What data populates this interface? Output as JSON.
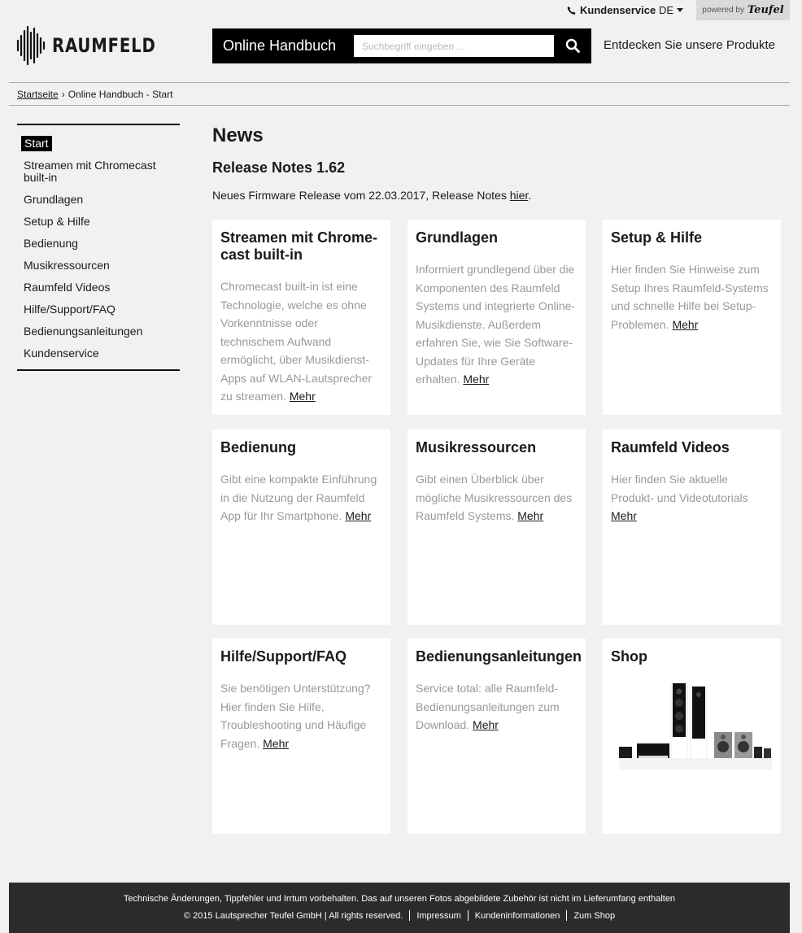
{
  "topbar": {
    "service_label": "Kundenservice",
    "lang_label": "DE",
    "powered_label": "powered by",
    "powered_brand": "Teufel"
  },
  "header": {
    "logo_text": "RAUMFELD",
    "search_title": "Online Handbuch",
    "search_placeholder": "Suchbegriff eingeben ...",
    "discover_label": "Entdecken Sie unsere Produkte"
  },
  "breadcrumb": {
    "home": "Startseite",
    "separator": "›",
    "current": "Online Handbuch - Start"
  },
  "sidebar": {
    "items": [
      {
        "label": "Start"
      },
      {
        "label": "Streamen mit Chromecast built-in"
      },
      {
        "label": "Grundlagen"
      },
      {
        "label": "Setup & Hilfe"
      },
      {
        "label": "Bedienung"
      },
      {
        "label": "Musikressourcen"
      },
      {
        "label": "Raumfeld Videos"
      },
      {
        "label": "Hilfe/Support/FAQ"
      },
      {
        "label": "Bedienungsanleitungen"
      },
      {
        "label": "Kundenservice"
      }
    ]
  },
  "main": {
    "title": "News",
    "release_title": "Release Notes 1.62",
    "release_text": "Neues Firmware Release vom 22.03.2017, Release Notes ",
    "release_link": "hier",
    "release_after": ".",
    "more_label": "Mehr",
    "cards": [
      {
        "title": "Streamen mit Chrome-cast built-in",
        "text": "Chromecast built-in ist eine Technologie, welche es ohne Vorkenntnisse oder technischem Aufwand ermöglicht, über Musikdienst-Apps auf WLAN-Lautsprecher zu streamen. "
      },
      {
        "title": "Grundlagen",
        "text": "Informiert grundlegend über die Komponenten des Raumfeld Systems und integrierte Online-Musikdienste. Außerdem erfahren Sie, wie Sie Software-Updates für Ihre Geräte erhalten. "
      },
      {
        "title": "Setup & Hilfe",
        "text": "Hier finden Sie Hinweise zum Setup Ihres Raumfeld-Systems und schnelle Hilfe bei Setup-Problemen. "
      },
      {
        "title": "Bedienung",
        "text": "Gibt eine kompakte Einführung in die Nutzung der Raumfeld App für Ihr Smartphone. "
      },
      {
        "title": "Musikressourcen",
        "text": "Gibt einen Überblick über mögliche Musikressourcen des Raumfeld Systems. "
      },
      {
        "title": "Raumfeld Videos",
        "text": "Hier finden Sie aktuelle Produkt- und Videotutorials "
      },
      {
        "title": "Hilfe/Support/FAQ",
        "text": "Sie benötigen Unterstützung? Hier finden Sie Hilfe, Troubleshooting und Häufige Fragen. "
      },
      {
        "title": "Bedienungsanleitungen",
        "text": "Service total: alle Raumfeld-Bedienungsanleitungen zum Download. "
      },
      {
        "title": "Shop",
        "text": ""
      }
    ]
  },
  "footer": {
    "disclaimer": "Technische Änderungen, Tippfehler und Irrtum vorbehalten. Das auf unseren Fotos abgebildete Zubehör ist nicht im Lieferumfang enthalten",
    "copyright": "© 2015 Lautsprecher Teufel GmbH | All rights reserved.",
    "links": [
      "Impressum",
      "Kundeninformationen",
      "Zum Shop"
    ]
  }
}
